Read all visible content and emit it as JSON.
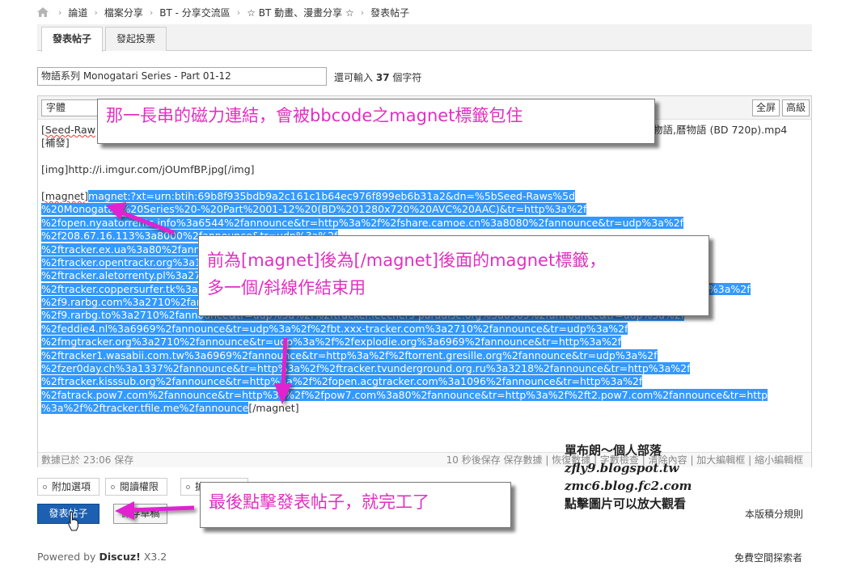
{
  "breadcrumb": [
    "論道",
    "檔案分享",
    "BT - 分享交流區",
    "☆ BT 動畫、漫畫分享 ☆",
    "發表帖子"
  ],
  "tabs": [
    "發表帖子",
    "發起投票"
  ],
  "title_input": {
    "value": "物語系列 Monogatari Series - Part 01-12"
  },
  "char_hint": {
    "prefix": "還可輸入",
    "count": "37",
    "suffix": "個字符"
  },
  "toolbar": {
    "font_select": "字體",
    "fullscreen": "全屏",
    "advanced": "高級"
  },
  "editor": {
    "line1_start": "[Seed-Raw",
    "line1_end": "物語,曆物語 (BD 720p).mp4",
    "line2": "[補發]",
    "img_line": "[img]http://i.imgur.com/jOUmfBP.jpg[/img]",
    "magnet_open": "[magnet]",
    "magnet_lines": [
      "magnet:?xt=urn:btih:69b8f935bdb9a2c161c1b64ec976f899eb6b31a2&dn=%5bSeed-Raws%5d",
      "%20Monogatari%20Series%20-%20Part%2001-12%20(BD%201280x720%20AVC%20AAC)&tr=http%3a%2f",
      "%2fopen.nyaatorrents.info%3a6544%2fannounce&tr=http%3a%2f%2fshare.camoe.cn%3a8080%2fannounce&tr=udp%3a%2f",
      "%2f208.67.16.113%3a8000%2fannounce&tr=udp%3a%2f",
      "%2ftracker.ex.ua%3a80%2fannounce&tr=http%3a%2f",
      "%2ftracker.opentrackr.org%3a1337%2fannounce&tr=http%3a%2f",
      "%2ftracker.aletorrenty.pl%3a2710%2fannounce&tr=http%3a%2f",
      "%2ftracker.coppersurfer.tk%3a6969%2fannounce&tr=http%3a%2f%2ftracker.leechers-paradise.org%3a6969%2fannounce&tr=udp%3a%2f",
      "%2f9.rarbg.com%3a2710%2fannounce&tr=udp%3a%2f",
      "%2f9.rarbg.to%3a2710%2fannounce&tr=udp%3a%2f%2ftracker.leechers-paradise.org%3a6969%2fannounce&tr=udp%3a%2f",
      "%2feddie4.nl%3a6969%2fannounce&tr=udp%3a%2f%2fbt.xxx-tracker.com%3a2710%2fannounce&tr=udp%3a%2f",
      "%2fmgtracker.org%3a2710%2fannounce&tr=udp%3a%2f%2fexplodie.org%3a6969%2fannounce&tr=http%3a%2f",
      "%2ftracker1.wasabii.com.tw%3a6969%2fannounce&tr=http%3a%2f%2ftorrent.gresille.org%2fannounce&tr=udp%3a%2f",
      "%2fzer0day.ch%3a1337%2fannounce&tr=http%3a%2f%2ftracker.tvunderground.org.ru%3a3218%2fannounce&tr=http%3a%2f",
      "%2ftracker.kisssub.org%2fannounce&tr=http%3a%2f%2fopen.acgtracker.com%3a1096%2fannounce&tr=http%3a%2f",
      "%2fatrack.pow7.com%2fannounce&tr=http%3a%2f%2fpow7.com%3a80%2fannounce&tr=http%3a%2f%2ft2.pow7.com%2fannounce&tr=http",
      "%3a%2f%2ftracker.tfile.me%2fannounce"
    ],
    "magnet_close": "[/magnet]"
  },
  "status": {
    "saved": "數據已於 23:06 保存",
    "autosave": "10 秒後保存 保存數據",
    "restore": "恢復數據",
    "wordcount": "字數檢查",
    "clear": "清除內容",
    "enlarge": "加大編輯框",
    "shrink": "縮小編輯框"
  },
  "options": [
    "附加選項",
    "閱讀權限",
    "搶"
  ],
  "buttons": {
    "submit": "發表帖子",
    "draft": "保存草稿"
  },
  "rules_link": "本版積分規則",
  "footer": {
    "powered_prefix": "Powered by",
    "brand": "Discuz!",
    "version": "X3.2",
    "right": "免費空間探索者"
  },
  "callouts": {
    "top": "那一長串的磁力連結，會被bbcode之magnet標籤包住",
    "middle_line1": "前為[magnet]後為[/magnet]後面的magnet標籤，",
    "middle_line2": "多一個/斜線作結束用",
    "bottom": "最後點擊發表帖子，就完工了"
  },
  "blog": {
    "name": "單布朗～個人部落",
    "site1": "zfly9.blogspot.tw",
    "site2": "zmc6.blog.fc2.com",
    "hint": "點擊圖片可以放大觀看"
  },
  "colors": {
    "callout_text": "#e030c0",
    "arrow": "#e020d0",
    "selection": "#3399ff",
    "submit": "#1d60b1"
  }
}
